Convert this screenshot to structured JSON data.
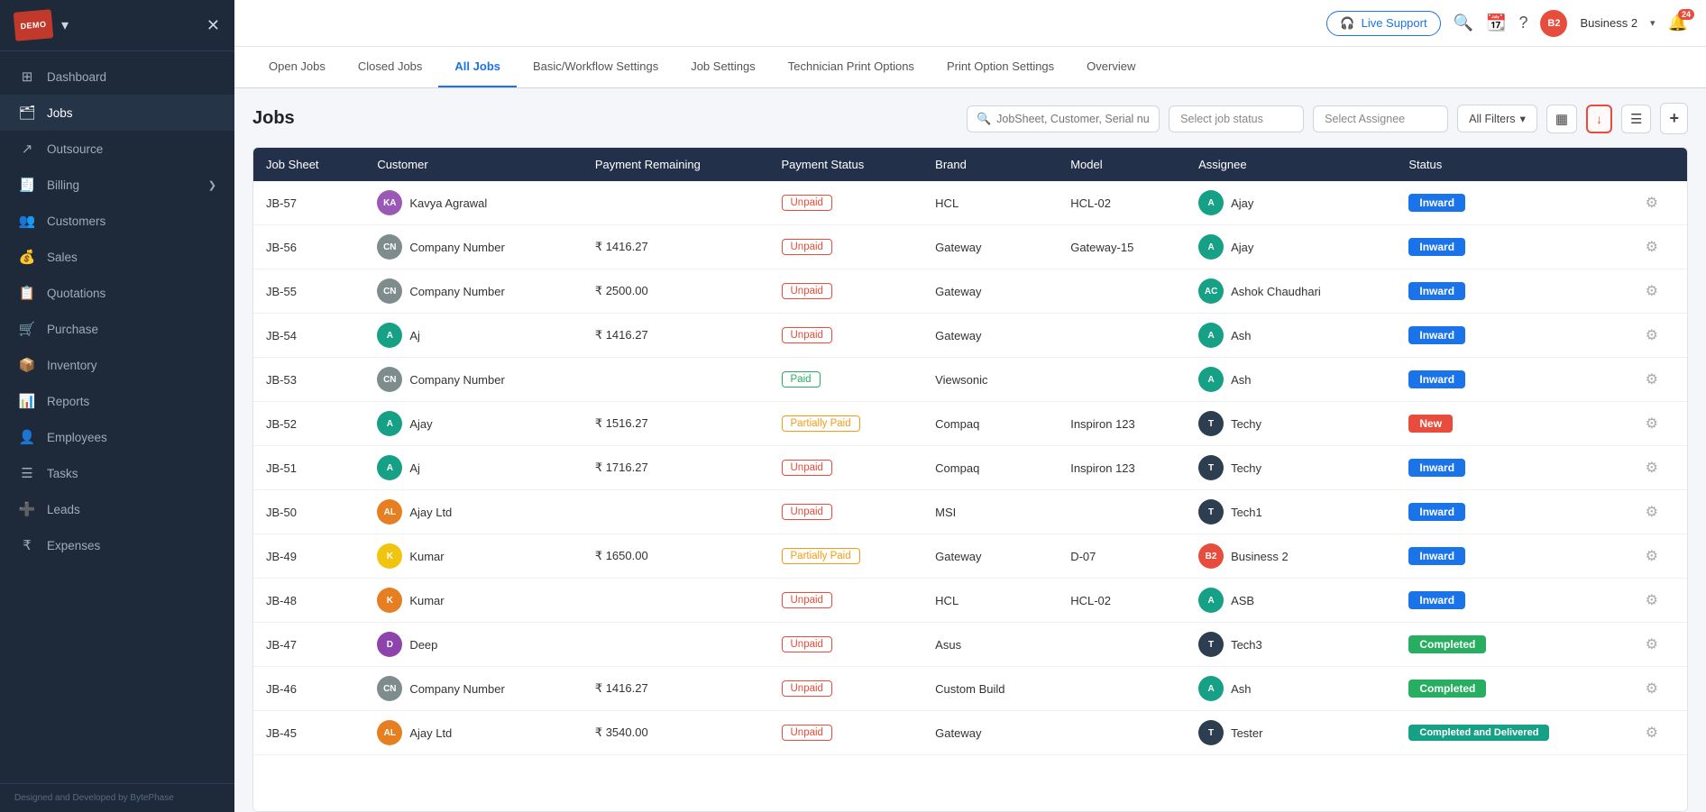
{
  "sidebar": {
    "logo_text": "DEMO",
    "nav_items": [
      {
        "id": "dashboard",
        "label": "Dashboard",
        "icon": "⊞"
      },
      {
        "id": "jobs",
        "label": "Jobs",
        "icon": "🗂",
        "active": true
      },
      {
        "id": "outsource",
        "label": "Outsource",
        "icon": "↗"
      },
      {
        "id": "billing",
        "label": "Billing",
        "icon": "🧾",
        "has_arrow": true
      },
      {
        "id": "customers",
        "label": "Customers",
        "icon": "👥"
      },
      {
        "id": "sales",
        "label": "Sales",
        "icon": "💰"
      },
      {
        "id": "quotations",
        "label": "Quotations",
        "icon": "📋"
      },
      {
        "id": "purchase",
        "label": "Purchase",
        "icon": "🛒"
      },
      {
        "id": "inventory",
        "label": "Inventory",
        "icon": "📦"
      },
      {
        "id": "reports",
        "label": "Reports",
        "icon": "📊"
      },
      {
        "id": "employees",
        "label": "Employees",
        "icon": "👤"
      },
      {
        "id": "tasks",
        "label": "Tasks",
        "icon": "☰"
      },
      {
        "id": "leads",
        "label": "Leads",
        "icon": "➕"
      },
      {
        "id": "expenses",
        "label": "Expenses",
        "icon": "₹"
      }
    ],
    "footer": "Designed and Developed by BytePhase"
  },
  "topbar": {
    "live_support_label": "Live Support",
    "user_initials": "B2",
    "username": "Business 2",
    "notification_count": "24"
  },
  "tabs": [
    {
      "id": "open-jobs",
      "label": "Open Jobs"
    },
    {
      "id": "closed-jobs",
      "label": "Closed Jobs"
    },
    {
      "id": "all-jobs",
      "label": "All Jobs",
      "active": true
    },
    {
      "id": "basic-workflow",
      "label": "Basic/Workflow Settings"
    },
    {
      "id": "job-settings",
      "label": "Job Settings"
    },
    {
      "id": "technician-print",
      "label": "Technician Print Options"
    },
    {
      "id": "print-option",
      "label": "Print Option Settings"
    },
    {
      "id": "overview",
      "label": "Overview"
    }
  ],
  "page_title": "Jobs",
  "search_placeholder": "JobSheet, Customer, Serial nu...",
  "status_placeholder": "Select job status",
  "assignee_placeholder": "Select Assignee",
  "all_filters_label": "All Filters",
  "table": {
    "headers": [
      "Job Sheet",
      "Customer",
      "Payment Remaining",
      "Payment Status",
      "Brand",
      "Model",
      "Assignee",
      "Status",
      ""
    ],
    "rows": [
      {
        "job_sheet": "JB-57",
        "customer": "Kavya Agrawal",
        "customer_initials": "KA",
        "customer_color": "#9b59b6",
        "payment_remaining": "",
        "payment_status": "Unpaid",
        "payment_type": "unpaid",
        "brand": "HCL",
        "model": "HCL-02",
        "assignee": "Ajay",
        "assignee_initial": "A",
        "assignee_color": "#16a085",
        "status": "Inward",
        "status_type": "inward"
      },
      {
        "job_sheet": "JB-56",
        "customer": "Company Number",
        "customer_initials": "CN",
        "customer_color": "#7f8c8d",
        "payment_remaining": "₹ 1416.27",
        "payment_status": "Unpaid",
        "payment_type": "unpaid",
        "brand": "Gateway",
        "model": "Gateway-15",
        "assignee": "Ajay",
        "assignee_initial": "A",
        "assignee_color": "#16a085",
        "status": "Inward",
        "status_type": "inward"
      },
      {
        "job_sheet": "JB-55",
        "customer": "Company Number",
        "customer_initials": "CN",
        "customer_color": "#7f8c8d",
        "payment_remaining": "₹ 2500.00",
        "payment_status": "Unpaid",
        "payment_type": "unpaid",
        "brand": "Gateway",
        "model": "",
        "assignee": "Ashok Chaudhari",
        "assignee_initial": "AC",
        "assignee_color": "#16a085",
        "status": "Inward",
        "status_type": "inward"
      },
      {
        "job_sheet": "JB-54",
        "customer": "Aj",
        "customer_initials": "A",
        "customer_color": "#16a085",
        "payment_remaining": "₹ 1416.27",
        "payment_status": "Unpaid",
        "payment_type": "unpaid",
        "brand": "Gateway",
        "model": "",
        "assignee": "Ash",
        "assignee_initial": "A",
        "assignee_color": "#16a085",
        "status": "Inward",
        "status_type": "inward"
      },
      {
        "job_sheet": "JB-53",
        "customer": "Company Number",
        "customer_initials": "CN",
        "customer_color": "#7f8c8d",
        "payment_remaining": "",
        "payment_status": "Paid",
        "payment_type": "paid",
        "brand": "Viewsonic",
        "model": "",
        "assignee": "Ash",
        "assignee_initial": "A",
        "assignee_color": "#16a085",
        "status": "Inward",
        "status_type": "inward"
      },
      {
        "job_sheet": "JB-52",
        "customer": "Ajay",
        "customer_initials": "A",
        "customer_color": "#16a085",
        "payment_remaining": "₹ 1516.27",
        "payment_status": "Partially Paid",
        "payment_type": "partial",
        "brand": "Compaq",
        "model": "Inspiron 123",
        "assignee": "Techy",
        "assignee_initial": "T",
        "assignee_color": "#2c3e50",
        "status": "New",
        "status_type": "new"
      },
      {
        "job_sheet": "JB-51",
        "customer": "Aj",
        "customer_initials": "A",
        "customer_color": "#16a085",
        "payment_remaining": "₹ 1716.27",
        "payment_status": "Unpaid",
        "payment_type": "unpaid",
        "brand": "Compaq",
        "model": "Inspiron 123",
        "assignee": "Techy",
        "assignee_initial": "T",
        "assignee_color": "#2c3e50",
        "status": "Inward",
        "status_type": "inward"
      },
      {
        "job_sheet": "JB-50",
        "customer": "Ajay Ltd",
        "customer_initials": "AL",
        "customer_color": "#e67e22",
        "payment_remaining": "",
        "payment_status": "Unpaid",
        "payment_type": "unpaid",
        "brand": "MSI",
        "model": "",
        "assignee": "Tech1",
        "assignee_initial": "T",
        "assignee_color": "#2c3e50",
        "status": "Inward",
        "status_type": "inward"
      },
      {
        "job_sheet": "JB-49",
        "customer": "Kumar",
        "customer_initials": "K",
        "customer_color": "#f1c40f",
        "payment_remaining": "₹ 1650.00",
        "payment_status": "Partially Paid",
        "payment_type": "partial",
        "brand": "Gateway",
        "model": "D-07",
        "assignee": "Business 2",
        "assignee_initial": "B2",
        "assignee_color": "#e74c3c",
        "status": "Inward",
        "status_type": "inward"
      },
      {
        "job_sheet": "JB-48",
        "customer": "Kumar",
        "customer_initials": "K",
        "customer_color": "#e67e22",
        "payment_remaining": "",
        "payment_status": "Unpaid",
        "payment_type": "unpaid",
        "brand": "HCL",
        "model": "HCL-02",
        "assignee": "ASB",
        "assignee_initial": "A",
        "assignee_color": "#16a085",
        "status": "Inward",
        "status_type": "inward"
      },
      {
        "job_sheet": "JB-47",
        "customer": "Deep",
        "customer_initials": "D",
        "customer_color": "#8e44ad",
        "payment_remaining": "",
        "payment_status": "Unpaid",
        "payment_type": "unpaid",
        "brand": "Asus",
        "model": "",
        "assignee": "Tech3",
        "assignee_initial": "T",
        "assignee_color": "#2c3e50",
        "status": "Completed",
        "status_type": "completed"
      },
      {
        "job_sheet": "JB-46",
        "customer": "Company Number",
        "customer_initials": "CN",
        "customer_color": "#7f8c8d",
        "payment_remaining": "₹ 1416.27",
        "payment_status": "Unpaid",
        "payment_type": "unpaid",
        "brand": "Custom Build",
        "model": "",
        "assignee": "Ash",
        "assignee_initial": "A",
        "assignee_color": "#16a085",
        "status": "Completed",
        "status_type": "completed"
      },
      {
        "job_sheet": "JB-45",
        "customer": "Ajay Ltd",
        "customer_initials": "AL",
        "customer_color": "#e67e22",
        "payment_remaining": "₹ 3540.00",
        "payment_status": "Unpaid",
        "payment_type": "unpaid",
        "brand": "Gateway",
        "model": "",
        "assignee": "Tester",
        "assignee_initial": "T",
        "assignee_color": "#2c3e50",
        "status": "Completed and Delivered",
        "status_type": "completed-delivered"
      }
    ]
  }
}
